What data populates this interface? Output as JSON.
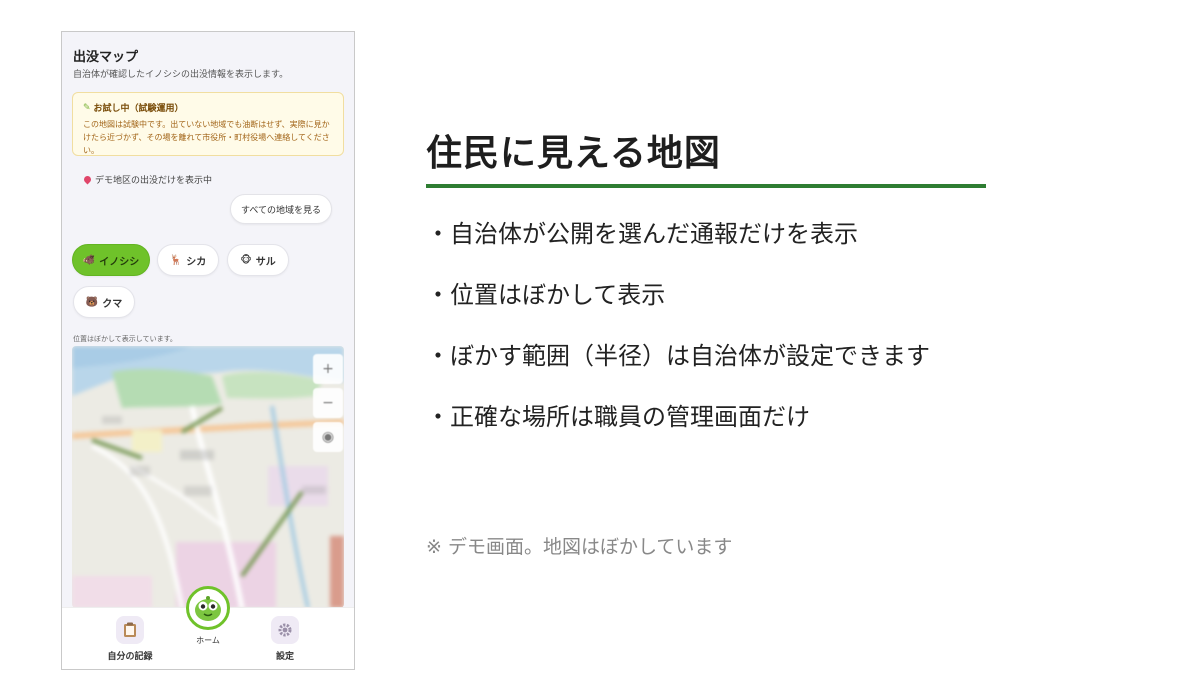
{
  "app": {
    "title": "出没マップ",
    "subtitle": "自治体が確認したイノシシの出没情報を表示します。"
  },
  "notice": {
    "heading": "お試し中（試験運用）",
    "body_line1": "この地図は試験中です。出ていない地域でも油断はせず、実際に見か",
    "body_line2": "けたら近づかず、その場を離れて市役所・町村役場へ連絡してください。"
  },
  "area": {
    "status": "デモ地区の出没だけを表示中",
    "all_areas_button": "すべての地域を見る"
  },
  "animals": [
    {
      "label": "イノシシ",
      "icon": "boar-icon",
      "emoji": "🐗",
      "active": true
    },
    {
      "label": "シカ",
      "icon": "deer-icon",
      "emoji": "🦌",
      "active": false
    },
    {
      "label": "サル",
      "icon": "monkey-icon",
      "emoji": "🐵",
      "active": false
    },
    {
      "label": "クマ",
      "icon": "bear-icon",
      "emoji": "🐻",
      "active": false
    }
  ],
  "map": {
    "note": "位置はぼかして表示しています。",
    "zoom_in": "+",
    "zoom_out": "−",
    "locate": "◉"
  },
  "nav": {
    "records": "自分の記録",
    "home": "ホーム",
    "settings": "設定"
  },
  "slide": {
    "title": "住民に見える地図",
    "bullets": [
      "・自治体が公開を選んだ通報だけを表示",
      "・位置はぼかして表示",
      "・ぼかす範囲（半径）は自治体が設定できます",
      "・正確な場所は職員の管理画面だけ"
    ],
    "footnote": "※ デモ画面。地図はぼかしています"
  },
  "colors": {
    "accent_green": "#6fc22a",
    "title_rule": "#2e7d32",
    "notice_bg": "#fffbe8",
    "notice_text": "#a3661a"
  }
}
